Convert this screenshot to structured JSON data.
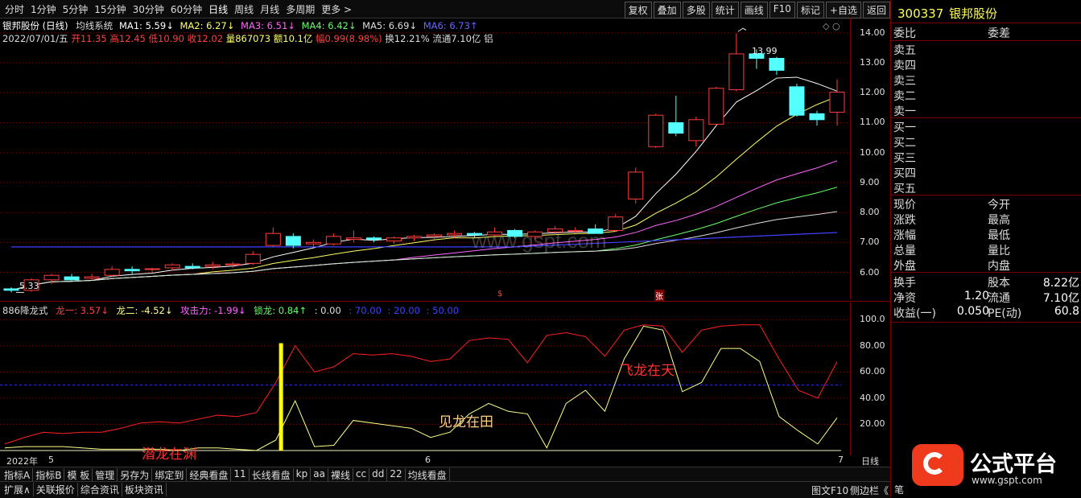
{
  "toolbar": {
    "periods": [
      "分时",
      "1分钟",
      "5分钟",
      "15分钟",
      "30分钟",
      "60分钟",
      "日线",
      "周线",
      "月线",
      "多周期",
      "更多 >"
    ],
    "tools": [
      "复权",
      "叠加",
      "多股",
      "统计",
      "画线",
      "F10",
      "标记",
      "+自选",
      "返回"
    ]
  },
  "chart_header": {
    "title": "银邦股份 (日线)",
    "system": "均线系统",
    "ma1": "MA1: 5.59↓",
    "ma2": "MA2: 6.27↓",
    "ma3": "MA3: 6.51↓",
    "ma4": "MA4: 6.42↓",
    "ma5": "MA5: 6.69↓",
    "ma6": "MA6: 6.73↑",
    "date": "2022/07/01/五",
    "open": "开11.35",
    "high": "高12.45",
    "low": "低10.90",
    "close": "收12.02",
    "vol": "量867073",
    "amt": "额10.1亿",
    "chg": "幅0.99(8.98%)",
    "turn": "换12.21%",
    "float": "流通7.10亿",
    "extra": "铝"
  },
  "price_axis": [
    "14.00",
    "13.00",
    "12.00",
    "11.00",
    "10.00",
    "9.00",
    "8.00",
    "7.00",
    "6.00"
  ],
  "price_markers": {
    "high": "13.99",
    "low": "5.33"
  },
  "watermark": "www.gspt.com",
  "indicator_header": {
    "name": "886降龙式",
    "l1": "龙一: 3.57↓",
    "l2": "龙二: -4.52↓",
    "atk": "攻击力: -1.99↓",
    "lock": "锁龙: 0.84↑",
    "v0": ": 0.00",
    "v70": ": 70.00",
    "v20": ": 20.00",
    "v50": ": 50.00"
  },
  "ind_axis": [
    "100.0",
    "80.00",
    "60.00",
    "40.00",
    "20.00"
  ],
  "annotations": {
    "qianlong": "潜龙在渊",
    "jianlong": "见龙在田",
    "feilong": "飞龙在天"
  },
  "chart_marks": {
    "s": "$",
    "zhang": "张"
  },
  "time_axis": {
    "year": "2022年",
    "m5": "5",
    "m6": "6",
    "m7": "7",
    "period": "日线",
    "plus": "+",
    "minus": "-"
  },
  "bottom_tabs1": [
    "指标A",
    "指标B",
    "模 板",
    "管理",
    "另存为",
    "绑定到",
    "经典看盘",
    "11",
    "长线看盘",
    "kp",
    "aa",
    "裸线",
    "cc",
    "dd",
    "22",
    "均线看盘"
  ],
  "bottom_tabs2": [
    "扩展∧",
    "关联报价",
    "综合资讯",
    "板块资讯"
  ],
  "bottom_right": {
    "f10": "图文F10",
    "side": "侧边栏《",
    "pen": "笔"
  },
  "right_panel": {
    "code": "300337",
    "name": "银邦股份",
    "weibi": "委比",
    "weicha": "委差",
    "sells": [
      "卖五",
      "卖四",
      "卖三",
      "卖二",
      "卖一"
    ],
    "buys": [
      "买一",
      "买二",
      "买三",
      "买四",
      "买五"
    ],
    "quote": [
      [
        "现价",
        "",
        "今开",
        ""
      ],
      [
        "涨跌",
        "",
        "最高",
        ""
      ],
      [
        "涨幅",
        "",
        "最低",
        ""
      ],
      [
        "总量",
        "",
        "量比",
        ""
      ],
      [
        "外盘",
        "",
        "内盘",
        ""
      ]
    ],
    "stats": [
      [
        "换手",
        "",
        "股本",
        "8.22亿"
      ],
      [
        "净资",
        "1.20",
        "流通",
        "7.10亿"
      ],
      [
        "收益(一)",
        "0.050",
        "PE(动)",
        "60.8"
      ]
    ]
  },
  "logo": {
    "text": "公式平台",
    "url": "www.gspt.com"
  },
  "chart_data": {
    "type": "candlestick",
    "ohlc": [
      [
        5.45,
        5.5,
        5.33,
        5.4
      ],
      [
        5.4,
        5.8,
        5.35,
        5.75
      ],
      [
        5.75,
        5.95,
        5.6,
        5.9
      ],
      [
        5.85,
        5.95,
        5.7,
        5.75
      ],
      [
        5.8,
        5.95,
        5.75,
        5.85
      ],
      [
        5.9,
        6.2,
        5.85,
        6.1
      ],
      [
        6.1,
        6.2,
        5.95,
        6.05
      ],
      [
        6.1,
        6.15,
        6.0,
        6.12
      ],
      [
        6.15,
        6.3,
        6.05,
        6.25
      ],
      [
        6.2,
        6.3,
        6.1,
        6.15
      ],
      [
        6.2,
        6.35,
        6.1,
        6.25
      ],
      [
        6.25,
        6.35,
        6.15,
        6.28
      ],
      [
        6.3,
        6.7,
        6.25,
        6.6
      ],
      [
        6.9,
        7.5,
        6.85,
        7.3
      ],
      [
        7.2,
        7.3,
        6.8,
        6.9
      ],
      [
        6.95,
        7.1,
        6.85,
        7.0
      ],
      [
        6.95,
        7.3,
        6.9,
        7.2
      ],
      [
        7.1,
        7.4,
        7.0,
        7.15
      ],
      [
        7.15,
        7.2,
        7.0,
        7.1
      ],
      [
        7.05,
        7.2,
        6.95,
        7.15
      ],
      [
        7.15,
        7.25,
        7.05,
        7.2
      ],
      [
        7.2,
        7.3,
        7.05,
        7.25
      ],
      [
        7.25,
        7.4,
        7.15,
        7.3
      ],
      [
        7.3,
        7.35,
        7.15,
        7.25
      ],
      [
        7.25,
        7.5,
        7.2,
        7.35
      ],
      [
        7.4,
        7.45,
        7.15,
        7.2
      ],
      [
        7.2,
        7.4,
        7.1,
        7.35
      ],
      [
        7.35,
        7.55,
        7.25,
        7.45
      ],
      [
        7.4,
        7.5,
        7.3,
        7.4
      ],
      [
        7.45,
        7.6,
        7.35,
        7.3
      ],
      [
        7.4,
        7.95,
        7.35,
        7.85
      ],
      [
        8.45,
        9.5,
        8.3,
        9.35
      ],
      [
        10.2,
        11.3,
        10.15,
        11.25
      ],
      [
        11.0,
        11.9,
        10.55,
        10.65
      ],
      [
        10.4,
        11.2,
        10.2,
        11.1
      ],
      [
        10.95,
        12.2,
        10.9,
        12.15
      ],
      [
        12.1,
        13.99,
        12.05,
        13.3
      ],
      [
        13.3,
        13.45,
        12.8,
        13.15
      ],
      [
        13.15,
        13.2,
        12.6,
        12.75
      ],
      [
        12.2,
        12.3,
        11.2,
        11.25
      ],
      [
        11.3,
        11.4,
        10.9,
        11.1
      ],
      [
        11.35,
        12.45,
        10.9,
        12.02
      ]
    ],
    "ylim": [
      5.1,
      14.4
    ],
    "indicator": {
      "red": [
        5,
        10,
        14,
        13,
        14,
        14,
        17,
        21,
        22,
        21,
        24,
        27,
        26,
        29,
        52,
        80,
        60,
        64,
        74,
        73,
        74,
        72,
        68,
        70,
        84,
        86,
        85,
        67,
        88,
        90,
        87,
        72,
        92,
        96,
        95,
        75,
        92,
        95,
        96,
        96,
        70,
        46,
        40,
        68
      ],
      "yellow": [
        2,
        3,
        3,
        3,
        2,
        1,
        1,
        1,
        1,
        0,
        2,
        2,
        1,
        0,
        8,
        38,
        3,
        4,
        23,
        21,
        19,
        17,
        10,
        14,
        28,
        36,
        30,
        28,
        2,
        36,
        46,
        30,
        70,
        95,
        92,
        45,
        52,
        78,
        78,
        68,
        26,
        15,
        5,
        25
      ],
      "ylim": [
        0,
        110
      ]
    }
  }
}
